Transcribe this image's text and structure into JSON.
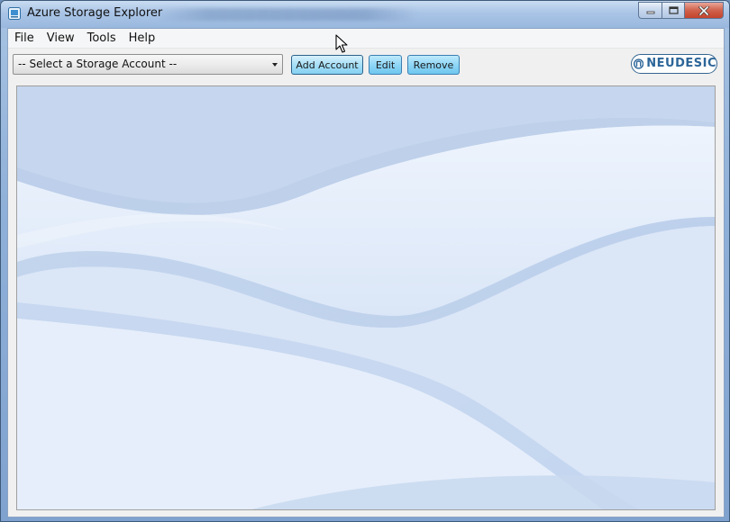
{
  "window": {
    "title": "Azure Storage Explorer",
    "icon": "storage-app-icon"
  },
  "menu": {
    "items": [
      {
        "label": "File"
      },
      {
        "label": "View"
      },
      {
        "label": "Tools"
      },
      {
        "label": "Help"
      }
    ]
  },
  "toolbar": {
    "account_select": {
      "selected": "-- Select a Storage Account --"
    },
    "add_account_label": "Add Account",
    "edit_label": "Edit",
    "remove_label": "Remove"
  },
  "logo": {
    "text": "NEUDESIC"
  },
  "colors": {
    "accent_button": "#8fd6f6",
    "title_bar": "#a9c4e6",
    "background_blue": "#cfdff4",
    "logo_blue": "#2d6699"
  }
}
